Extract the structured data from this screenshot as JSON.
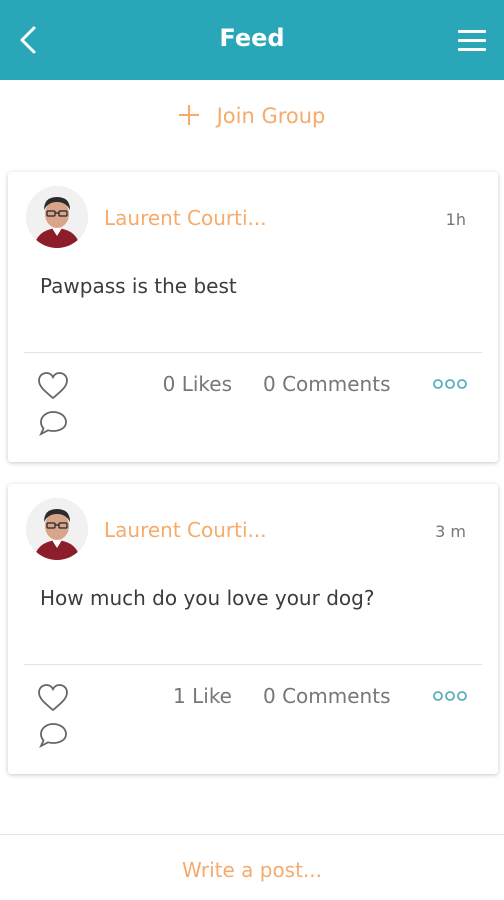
{
  "header": {
    "title": "Feed",
    "back_icon": "chevron-left-icon",
    "menu_icon": "hamburger-menu-icon",
    "color": "#2aa6b9"
  },
  "join_group": {
    "label": "Join Group",
    "icon": "plus-icon",
    "color": "#f6ab6a"
  },
  "posts": [
    {
      "author": "Laurent Courti...",
      "time": "1h",
      "text": "Pawpass is the best",
      "likes": "0 Likes",
      "comments": "0 Comments"
    },
    {
      "author": "Laurent Courti...",
      "time": "3 m",
      "text": "How much do you love your dog?",
      "likes": "1 Like",
      "comments": "0 Comments"
    }
  ],
  "composer": {
    "placeholder": "Write a post..."
  }
}
